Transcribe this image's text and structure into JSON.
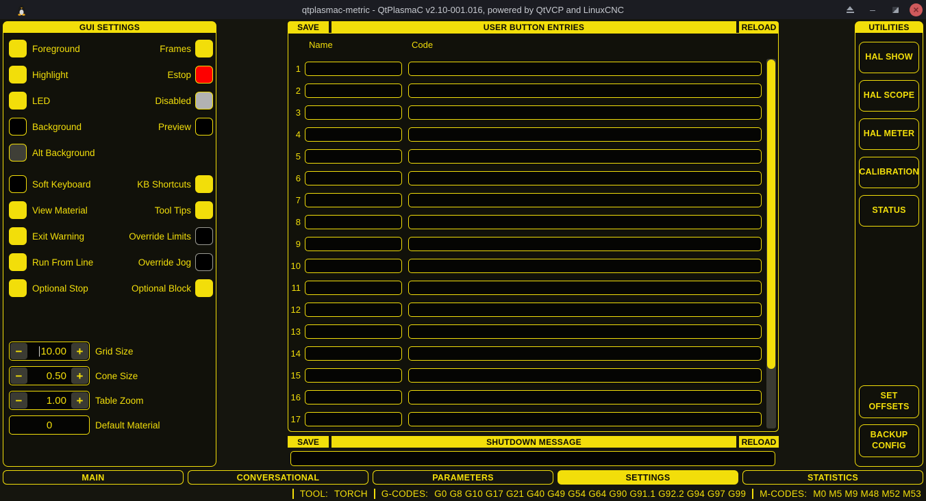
{
  "window": {
    "title": "qtplasmac-metric - QtPlasmaC v2.10-001.016, powered by QtVCP and LinuxCNC",
    "controls": {
      "minimize": "–",
      "close": "×"
    }
  },
  "colors": {
    "accent": "#f2de0a",
    "background": "#15150e",
    "estop_red": "#fe0000",
    "disabled_gray": "#b2b2b2",
    "preview_black": "#000000",
    "alt_background_gray": "#3f3f37"
  },
  "gui_settings": {
    "title": "GUI SETTINGS",
    "rows": [
      {
        "left": {
          "key": "foreground",
          "label": "Foreground",
          "type": "color",
          "color": "#f2de0a",
          "border": "#f2de0a"
        },
        "right": {
          "key": "frames",
          "label": "Frames",
          "type": "color",
          "color": "#f2de0a",
          "border": "#f2de0a"
        }
      },
      {
        "left": {
          "key": "highlight",
          "label": "Highlight",
          "type": "color",
          "color": "#f2de0a",
          "border": "#f2de0a"
        },
        "right": {
          "key": "estop",
          "label": "Estop",
          "type": "color",
          "color": "#fe0000",
          "border": "#f2de0a"
        }
      },
      {
        "left": {
          "key": "led",
          "label": "LED",
          "type": "color",
          "color": "#f2de0a",
          "border": "#f2de0a"
        },
        "right": {
          "key": "disabled",
          "label": "Disabled",
          "type": "color",
          "color": "#b2b2b2",
          "border": "#f2de0a"
        }
      },
      {
        "left": {
          "key": "background",
          "label": "Background",
          "type": "color",
          "color": "#000000",
          "border": "#f2de0a"
        },
        "right": {
          "key": "preview",
          "label": "Preview",
          "type": "color",
          "color": "#000000",
          "border": "#f2de0a"
        }
      },
      {
        "left": {
          "key": "alt-background",
          "label": "Alt Background",
          "type": "color",
          "color": "#3f3f37",
          "border": "#f2de0a"
        },
        "right": null
      },
      {
        "left": {
          "key": "soft-keyboard",
          "label": "Soft Keyboard",
          "type": "checkbox",
          "color": "#000000",
          "border": "#f2de0a"
        },
        "right": {
          "key": "kb-shortcuts",
          "label": "KB Shortcuts",
          "type": "checkbox",
          "color": "#f2de0a",
          "border": "#f2de0a"
        }
      },
      {
        "left": {
          "key": "view-material",
          "label": "View Material",
          "type": "checkbox",
          "color": "#f2de0a",
          "border": "#f2de0a"
        },
        "right": {
          "key": "tool-tips",
          "label": "Tool Tips",
          "type": "checkbox",
          "color": "#f2de0a",
          "border": "#f2de0a"
        }
      },
      {
        "left": {
          "key": "exit-warning",
          "label": "Exit Warning",
          "type": "checkbox",
          "color": "#f2de0a",
          "border": "#f2de0a"
        },
        "right": {
          "key": "override-limits",
          "label": "Override Limits",
          "type": "checkbox",
          "color": "#000000",
          "border": "#9b9b93"
        }
      },
      {
        "left": {
          "key": "run-from-line",
          "label": "Run From Line",
          "type": "checkbox",
          "color": "#f2de0a",
          "border": "#f2de0a"
        },
        "right": {
          "key": "override-jog",
          "label": "Override Jog",
          "type": "checkbox",
          "color": "#000000",
          "border": "#9b9b93"
        }
      },
      {
        "left": {
          "key": "optional-stop",
          "label": "Optional Stop",
          "type": "checkbox",
          "color": "#f2de0a",
          "border": "#f2de0a"
        },
        "right": {
          "key": "optional-block",
          "label": "Optional Block",
          "type": "checkbox",
          "color": "#f2de0a",
          "border": "#f2de0a"
        }
      }
    ],
    "spinners": [
      {
        "key": "grid-size",
        "type": "spin",
        "value": "10.00",
        "label": "Grid Size",
        "minus": "−",
        "plus": "+",
        "caret": true
      },
      {
        "key": "cone-size",
        "type": "spin",
        "value": "0.50",
        "label": "Cone Size",
        "minus": "−",
        "plus": "+",
        "caret": false
      },
      {
        "key": "table-zoom",
        "type": "spin",
        "value": "1.00",
        "label": "Table Zoom",
        "minus": "−",
        "plus": "+",
        "caret": false
      },
      {
        "key": "default-material",
        "type": "field",
        "value": "0",
        "label": "Default Material"
      }
    ]
  },
  "user_buttons": {
    "save_label": "SAVE",
    "title": "USER BUTTON ENTRIES",
    "reload_label": "RELOAD",
    "name_header": "Name",
    "code_header": "Code",
    "rows": [
      {
        "num": "1",
        "name": "",
        "code": ""
      },
      {
        "num": "2",
        "name": "",
        "code": ""
      },
      {
        "num": "3",
        "name": "",
        "code": ""
      },
      {
        "num": "4",
        "name": "",
        "code": ""
      },
      {
        "num": "5",
        "name": "",
        "code": ""
      },
      {
        "num": "6",
        "name": "",
        "code": ""
      },
      {
        "num": "7",
        "name": "",
        "code": ""
      },
      {
        "num": "8",
        "name": "",
        "code": ""
      },
      {
        "num": "9",
        "name": "",
        "code": ""
      },
      {
        "num": "10",
        "name": "",
        "code": ""
      },
      {
        "num": "11",
        "name": "",
        "code": ""
      },
      {
        "num": "12",
        "name": "",
        "code": ""
      },
      {
        "num": "13",
        "name": "",
        "code": ""
      },
      {
        "num": "14",
        "name": "",
        "code": ""
      },
      {
        "num": "15",
        "name": "",
        "code": ""
      },
      {
        "num": "16",
        "name": "",
        "code": ""
      },
      {
        "num": "17",
        "name": "",
        "code": ""
      }
    ]
  },
  "shutdown": {
    "save_label": "SAVE",
    "title": "SHUTDOWN MESSAGE",
    "reload_label": "RELOAD",
    "value": ""
  },
  "utilities": {
    "title": "UTILITIES",
    "buttons": [
      {
        "key": "hal-show",
        "label": "HAL SHOW"
      },
      {
        "key": "hal-scope",
        "label": "HAL SCOPE"
      },
      {
        "key": "hal-meter",
        "label": "HAL METER"
      },
      {
        "key": "calibration",
        "label": "CALIBRATION"
      },
      {
        "key": "status",
        "label": "STATUS"
      }
    ],
    "bottom_buttons": [
      {
        "key": "set-offsets",
        "label": "SET OFFSETS"
      },
      {
        "key": "backup-config",
        "label": "BACKUP CONFIG"
      }
    ]
  },
  "tabs": [
    {
      "key": "main",
      "label": "MAIN",
      "active": false
    },
    {
      "key": "conversational",
      "label": "CONVERSATIONAL",
      "active": false
    },
    {
      "key": "parameters",
      "label": "PARAMETERS",
      "active": false
    },
    {
      "key": "settings",
      "label": "SETTINGS",
      "active": true
    },
    {
      "key": "statistics",
      "label": "STATISTICS",
      "active": false
    }
  ],
  "status_bar": {
    "tool_label": "TOOL:",
    "tool_value": "TORCH",
    "gcodes_label": "G-CODES:",
    "gcodes_value": "G0 G8 G10 G17 G21 G40 G49 G54 G64 G90 G91.1 G92.2 G94 G97 G99",
    "mcodes_label": "M-CODES:",
    "mcodes_value": "M0 M5 M9 M48 M52 M53"
  }
}
